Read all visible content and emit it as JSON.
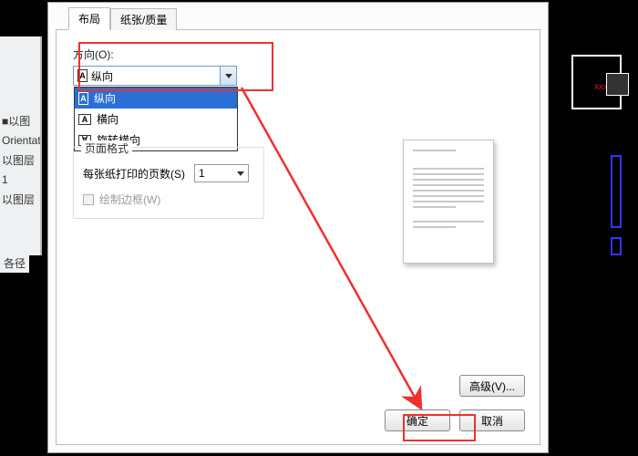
{
  "background": {
    "left_panel_rows": [
      "■以图",
      "Orientat",
      "以图层",
      "1",
      "以图层"
    ],
    "left_truncated": "各径",
    "red_label": "xxxx"
  },
  "dialog": {
    "tabs": [
      {
        "label": "布局",
        "active": true
      },
      {
        "label": "纸张/质量",
        "active": false
      }
    ],
    "orientation": {
      "label": "方向(O):",
      "selected": "纵向",
      "options": [
        {
          "glyph": "A",
          "shape": "portrait",
          "label": "纵向",
          "selected": true
        },
        {
          "glyph": "A",
          "shape": "landscape",
          "label": "横向",
          "selected": false
        },
        {
          "glyph": "∀",
          "shape": "landscape",
          "label": "旋转横向",
          "selected": false
        }
      ]
    },
    "page_format": {
      "legend": "页面格式",
      "pages_per_sheet_label": "每张纸打印的页数(S)",
      "pages_per_sheet_value": "1",
      "draw_border_label": "绘制边框(W)",
      "draw_border_checked": false,
      "draw_border_enabled": false
    },
    "buttons": {
      "advanced": "高级(V)...",
      "ok": "确定",
      "cancel": "取消"
    }
  },
  "annotation": {
    "highlight_boxes": [
      "orientation-group",
      "ok-button"
    ],
    "arrow_color": "#f0302f"
  }
}
